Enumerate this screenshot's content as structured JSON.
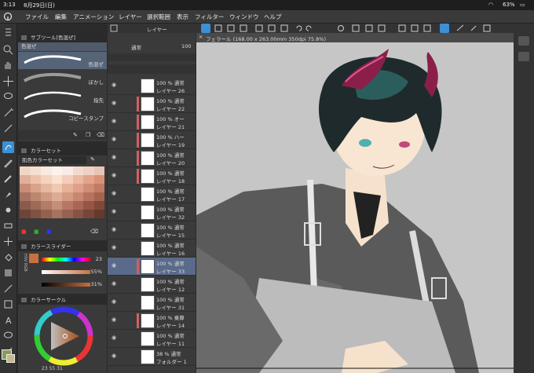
{
  "status": {
    "time": "3:13",
    "date": "8月29日(日)",
    "battery": "63%"
  },
  "menu": [
    "ファイル",
    "編集",
    "アニメーション",
    "レイヤー",
    "選択範囲",
    "表示",
    "フィルター",
    "ウィンドウ",
    "ヘルプ"
  ],
  "subtool": {
    "title": "サブツール[色混ぜ]",
    "group": "色混ぜ",
    "brushes": [
      {
        "label": "色混ぜ"
      },
      {
        "label": "ぼかし"
      },
      {
        "label": "指先"
      },
      {
        "label": "コピースタンプ"
      }
    ]
  },
  "colorset": {
    "title": "カラーセット",
    "selected": "肌色カラーセット",
    "swatches": [
      "#f2d6c4",
      "#f5dfd0",
      "#fae9df",
      "#fdf2ea",
      "#f9ebe6",
      "#f4d9cf",
      "#eed1c4",
      "#e9c4b6",
      "#e0b09c",
      "#edc2aa",
      "#f4d2bd",
      "#f9e1cf",
      "#f2cdbc",
      "#ebb8a2",
      "#e2a58b",
      "#d99278",
      "#c78d78",
      "#d9a38b",
      "#e6b89f",
      "#f0c9b0",
      "#e7b19a",
      "#dea08a",
      "#d18c77",
      "#c17a66",
      "#a97261",
      "#bd866f",
      "#cf9a82",
      "#deac93",
      "#d59a84",
      "#c98670",
      "#b8735f",
      "#a5634f",
      "#8b5a4c",
      "#9d6a58",
      "#b27c67",
      "#c48e78",
      "#b77764",
      "#a96655",
      "#955547",
      "#824739",
      "#6f453a",
      "#7e5244",
      "#93624f",
      "#a5735e",
      "#966251",
      "#875344",
      "#774539",
      "#66392e"
    ]
  },
  "colorslider": {
    "title": "カラースライダー",
    "modes": [
      "HSV",
      "RGB",
      "CMY"
    ],
    "values": [
      "23",
      "55%",
      "31%"
    ]
  },
  "colorcircle": {
    "title": "カラーサークル",
    "values": [
      "23",
      "55",
      "31"
    ]
  },
  "layers": {
    "title": "レイヤー",
    "blend": "通常",
    "opacity": "100",
    "rows": [
      {
        "mode": "100 % 通常",
        "name": "レイヤー 26",
        "clip": false
      },
      {
        "mode": "100 % 通常",
        "name": "レイヤー 22",
        "clip": true
      },
      {
        "mode": "100 % オー",
        "name": "レイヤー 21",
        "clip": true
      },
      {
        "mode": "100 % ハー",
        "name": "レイヤー 19",
        "clip": true
      },
      {
        "mode": "100 % 通常",
        "name": "レイヤー 20",
        "clip": true
      },
      {
        "mode": "100 % 通常",
        "name": "レイヤー 18",
        "clip": true
      },
      {
        "mode": "100 % 通常",
        "name": "レイヤー 17",
        "clip": false
      },
      {
        "mode": "100 % 通常",
        "name": "レイヤー 32",
        "clip": false
      },
      {
        "mode": "100 % 通常",
        "name": "レイヤー 15",
        "clip": false
      },
      {
        "mode": "100 % 通常",
        "name": "レイヤー 16",
        "clip": false
      },
      {
        "mode": "100 % 通常",
        "name": "レイヤー 33",
        "clip": true,
        "selected": true
      },
      {
        "mode": "100 % 通常",
        "name": "レイヤー 12",
        "clip": false
      },
      {
        "mode": "100 % 通常",
        "name": "レイヤー 31",
        "clip": false
      },
      {
        "mode": "100 % 乗算",
        "name": "レイヤー 14",
        "clip": true
      },
      {
        "mode": "100 % 通常",
        "name": "レイヤー 11",
        "clip": false
      },
      {
        "mode": "38 % 通常",
        "name": "フォルダー 1",
        "clip": false
      }
    ]
  },
  "canvas": {
    "title": "フェラール (168.00 x 263.00mm 350dpi 75.8%)"
  },
  "colors": {
    "accent": "#3d8fd6",
    "panel": "#3a3a3a",
    "canvasbg": "#c6c6c6"
  }
}
